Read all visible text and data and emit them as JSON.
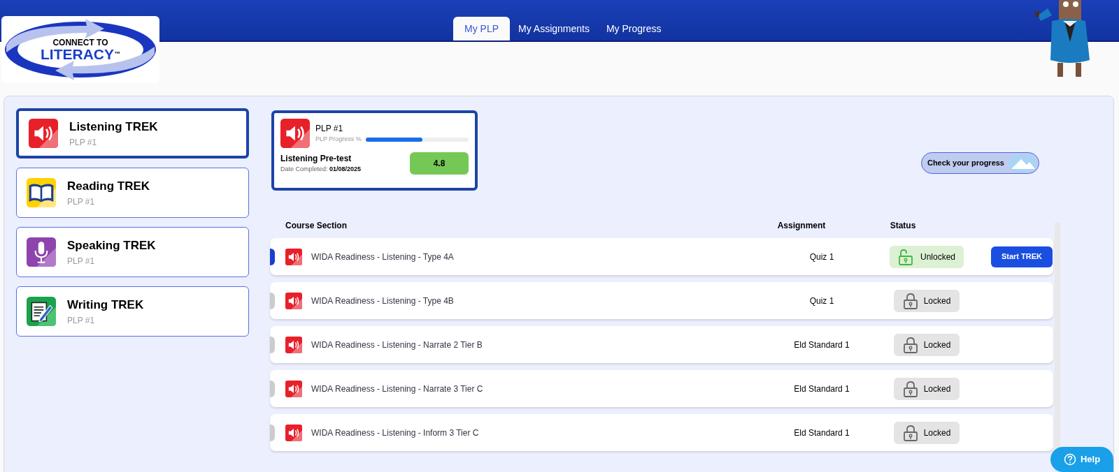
{
  "logo": {
    "line1": "CONNECT TO",
    "line2": "LITERACY",
    "mark": "™"
  },
  "tabs": [
    {
      "label": "My PLP",
      "selected": true
    },
    {
      "label": "My Assignments",
      "selected": false
    },
    {
      "label": "My Progress",
      "selected": false
    }
  ],
  "sidebar": {
    "items": [
      {
        "title": "Listening TREK",
        "subtitle": "PLP #1",
        "kind": "listening",
        "selected": true
      },
      {
        "title": "Reading TREK",
        "subtitle": "PLP #1",
        "kind": "reading",
        "selected": false
      },
      {
        "title": "Speaking TREK",
        "subtitle": "PLP #1",
        "kind": "speaking",
        "selected": false
      },
      {
        "title": "Writing TREK",
        "subtitle": "PLP #1",
        "kind": "writing",
        "selected": false
      }
    ]
  },
  "plp_card": {
    "title": "PLP #1",
    "progress_label": "PLP Progress %",
    "level": 0.55,
    "test_name": "Listening Pre-test",
    "date_label": "Date Completed:",
    "date": "01/08/2025",
    "score": "4.8"
  },
  "progress_button": {
    "label": "Check your progress"
  },
  "table": {
    "columns": [
      "Course Section",
      "Assignment",
      "Status"
    ],
    "rows": [
      {
        "section": "WIDA Readiness - Listening - Type 4A",
        "assignment": "Quiz 1",
        "status": "Unlocked",
        "kind": "unlocked",
        "selected": true,
        "action": "Start TREK"
      },
      {
        "section": "WIDA Readiness - Listening - Type 4B",
        "assignment": "Quiz 1",
        "status": "Locked",
        "kind": "locked",
        "selected": false
      },
      {
        "section": "WIDA Readiness - Listening - Narrate 2 Tier B",
        "assignment": "Eld Standard 1",
        "status": "Locked",
        "kind": "locked",
        "selected": false
      },
      {
        "section": "WIDA Readiness - Listening - Narrate 3 Tier C",
        "assignment": "Eld Standard 1",
        "status": "Locked",
        "kind": "locked",
        "selected": false
      },
      {
        "section": "WIDA Readiness - Listening - Inform 3 Tier C",
        "assignment": "Eld Standard 1",
        "status": "Locked",
        "kind": "locked",
        "selected": false
      }
    ]
  },
  "help_button": {
    "label": "Help"
  }
}
